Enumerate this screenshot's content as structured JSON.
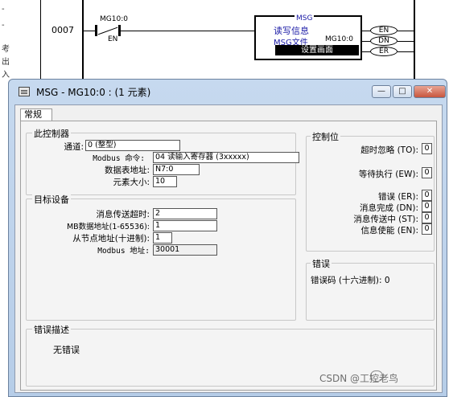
{
  "background": {
    "left_strip_chars": [
      "-",
      "-",
      "考",
      "出",
      "入"
    ],
    "rung_number": "0007",
    "contact_tag": "MG10:0",
    "contact_bit": "EN",
    "msg_block": {
      "header": "MSG",
      "line1": "读写信息",
      "line2_label": "MSG文件",
      "line2_value": "MG10:0",
      "button": "设置画面"
    },
    "coils": [
      "EN",
      "DN",
      "ER"
    ]
  },
  "dialog": {
    "title": "MSG - MG10:0 : (1 元素)",
    "controls": {
      "minimize": "—",
      "maximize": "□",
      "close": "✕"
    },
    "tab_label": "常规",
    "this_controller": {
      "group_label": "此控制器",
      "channel_label": "通道:",
      "channel_value": "0 (整型)",
      "command_label": "Modbus 命令:",
      "command_value": "04 读输入寄存器 (3xxxxx)",
      "table_label": "数据表地址:",
      "table_value": "N7:0",
      "size_label": "元素大小:",
      "size_value": "10"
    },
    "target_device": {
      "group_label": "目标设备",
      "timeout_label": "消息传送超时:",
      "timeout_value": "2",
      "mb_addr_label": "MB数据地址(1-65536):",
      "mb_addr_value": "1",
      "slave_label": "从节点地址(十进制):",
      "slave_value": "1",
      "modbus_addr_label": "Modbus 地址:",
      "modbus_addr_value": "30001"
    },
    "control_bits": {
      "group_label": "控制位",
      "items": [
        {
          "label": "超时忽略 (TO):",
          "value": "0"
        },
        {
          "label": "等待执行 (EW):",
          "value": "0"
        },
        {
          "label": "错误 (ER):",
          "value": "0"
        },
        {
          "label": "消息完成 (DN):",
          "value": "0"
        },
        {
          "label": "消息传送中 (ST):",
          "value": "0"
        },
        {
          "label": "信息使能 (EN):",
          "value": "0"
        }
      ]
    },
    "error": {
      "group_label": "错误",
      "code_text": "错误码 (十六进制): 0"
    },
    "error_description": {
      "group_label": "错误描述",
      "text": "无错误"
    }
  },
  "watermark": "CSDN @工控老鸟"
}
